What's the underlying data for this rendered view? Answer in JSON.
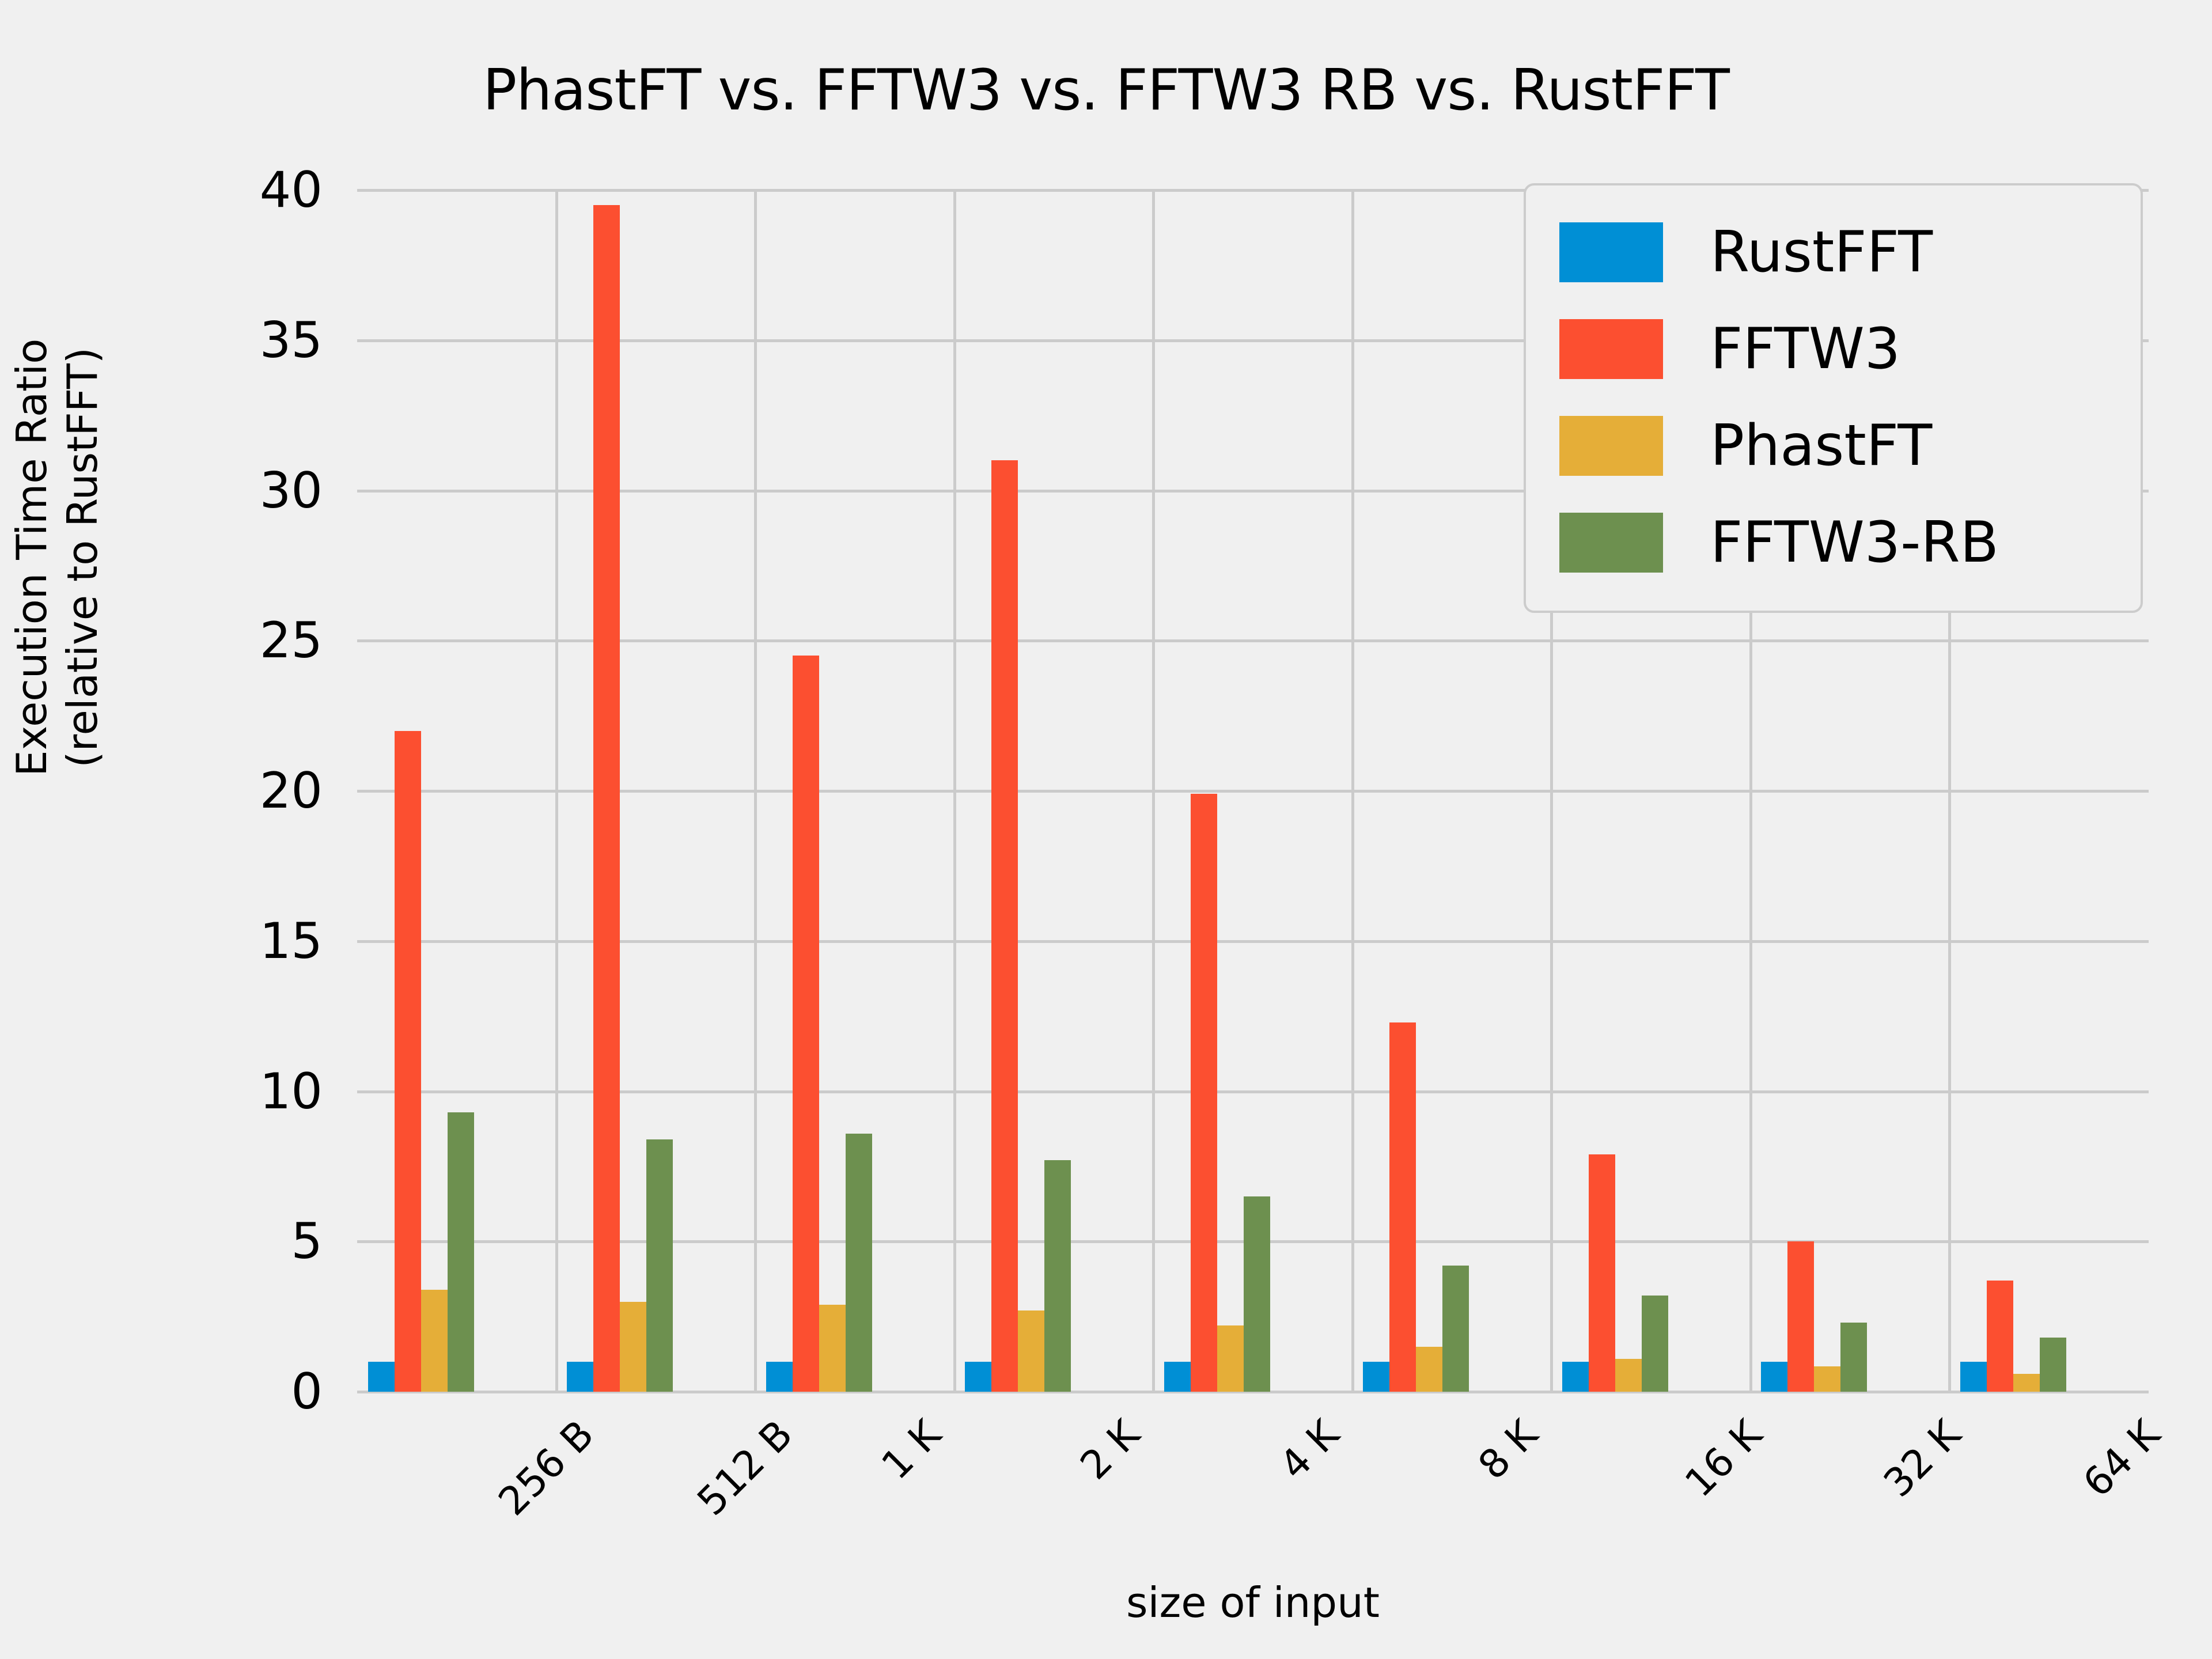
{
  "chart_data": {
    "type": "bar",
    "title": "PhastFT vs. FFTW3 vs. FFTW3 RB vs. RustFFT",
    "xlabel": "size of input",
    "ylabel": "Execution Time Ratio\n(relative to RustFFT)",
    "ylabel_line1": "Execution Time Ratio",
    "ylabel_line2": "(relative to RustFFT)",
    "categories": [
      "256 B",
      "512 B",
      "1 K",
      "2 K",
      "4 K",
      "8 K",
      "16 K",
      "32 K",
      "64 K"
    ],
    "series": [
      {
        "name": "RustFFT",
        "color": "#008FD5",
        "values": [
          1.0,
          1.0,
          1.0,
          1.0,
          1.0,
          1.0,
          1.0,
          1.0,
          1.0
        ]
      },
      {
        "name": "FFTW3",
        "color": "#FC4F30",
        "values": [
          22.0,
          39.5,
          24.5,
          31.0,
          19.9,
          12.3,
          7.9,
          5.0,
          3.7
        ]
      },
      {
        "name": "PhastFT",
        "color": "#E5AE38",
        "values": [
          3.4,
          3.0,
          2.9,
          2.7,
          2.2,
          1.5,
          1.1,
          0.85,
          0.6
        ]
      },
      {
        "name": "FFTW3-RB",
        "color": "#6D904F",
        "values": [
          9.3,
          8.4,
          8.6,
          7.7,
          6.5,
          4.2,
          3.2,
          2.3,
          1.8
        ]
      }
    ],
    "ylim": [
      0,
      40
    ],
    "yticks": [
      0,
      5,
      10,
      15,
      20,
      25,
      30,
      35,
      40
    ],
    "ytick_labels": [
      "0",
      "5",
      "10",
      "15",
      "20",
      "25",
      "30",
      "35",
      "40"
    ],
    "grid": true,
    "legend_position": "upper right",
    "legend_entries": [
      "RustFFT",
      "FFTW3",
      "PhastFT",
      "FFTW3-RB"
    ],
    "xtick_rotation": -45,
    "background_color": "#F0F0F0",
    "grid_color": "#CBCBCB"
  }
}
